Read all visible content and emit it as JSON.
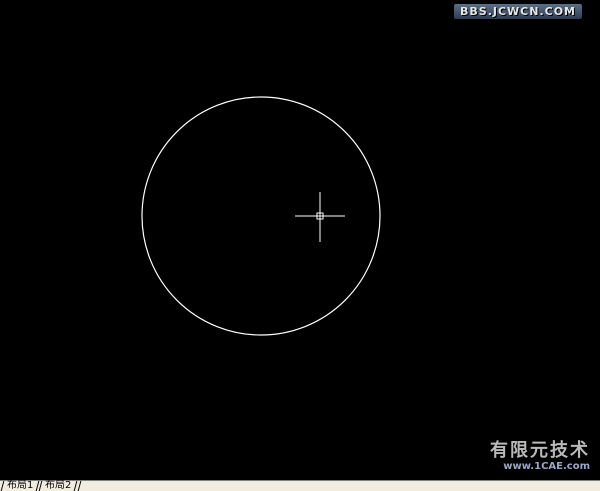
{
  "watermark": {
    "top": "BBS.JCWCN.COM",
    "bottom_cn": "有限元技术",
    "bottom_url": "www.1CAE.com"
  },
  "layout_tabs": [
    {
      "label": "布局1"
    },
    {
      "label": "布局2"
    }
  ],
  "colors": {
    "canvas": "#000000",
    "entity": "#ffffff",
    "tab_bar": "#f0ece0"
  },
  "icons": {
    "cursor": "crosshair-cursor-icon"
  }
}
